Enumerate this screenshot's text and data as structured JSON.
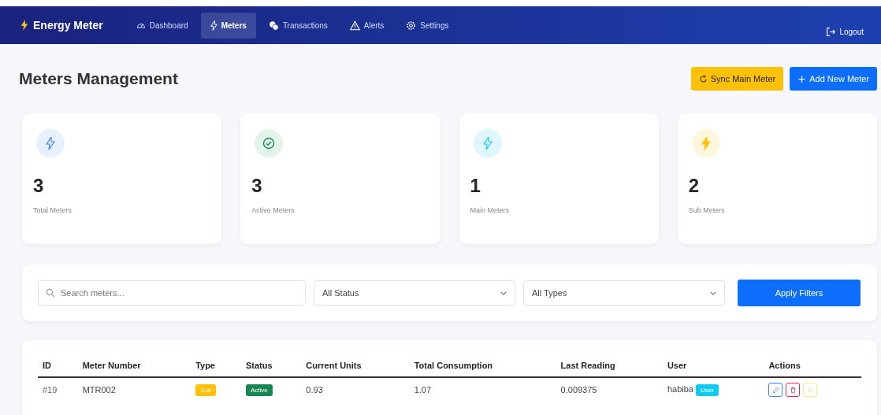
{
  "navbar": {
    "brand": "Energy Meter",
    "items": [
      {
        "label": "Dashboard",
        "selected": false
      },
      {
        "label": "Meters",
        "selected": true
      },
      {
        "label": "Transactions",
        "selected": false
      },
      {
        "label": "Alerts",
        "selected": false
      },
      {
        "label": "Settings",
        "selected": false
      }
    ],
    "logout": "Logout"
  },
  "page_title": "Meters Management",
  "actions": [
    {
      "label": "Sync Main Meter",
      "kind": "sync"
    },
    {
      "label": "Add New Meter",
      "kind": "add"
    }
  ],
  "stats": [
    {
      "value": "3",
      "label": "Total Meters",
      "kind": "total"
    },
    {
      "value": "3",
      "label": "Active Meters",
      "kind": "active"
    },
    {
      "value": "1",
      "label": "Main Meters",
      "kind": "main"
    },
    {
      "value": "2",
      "label": "Sub Meters",
      "kind": "sub"
    }
  ],
  "filters": {
    "search_placeholder": "Search meters...",
    "status": "All Status",
    "type": "All Types",
    "apply": "Apply Filters"
  },
  "table": {
    "columns": [
      "ID",
      "Meter Number",
      "Type",
      "Status",
      "Current Units",
      "Total Consumption",
      "Last Reading",
      "User",
      "Actions"
    ],
    "rows": [
      {
        "id": "#19",
        "meter_number": "MTR002",
        "type": "Sub",
        "status": "Active",
        "current_units": "0.93",
        "total_consumption": "1.07",
        "last_reading": "0.009375",
        "user": "habiba",
        "role": "User"
      }
    ]
  }
}
